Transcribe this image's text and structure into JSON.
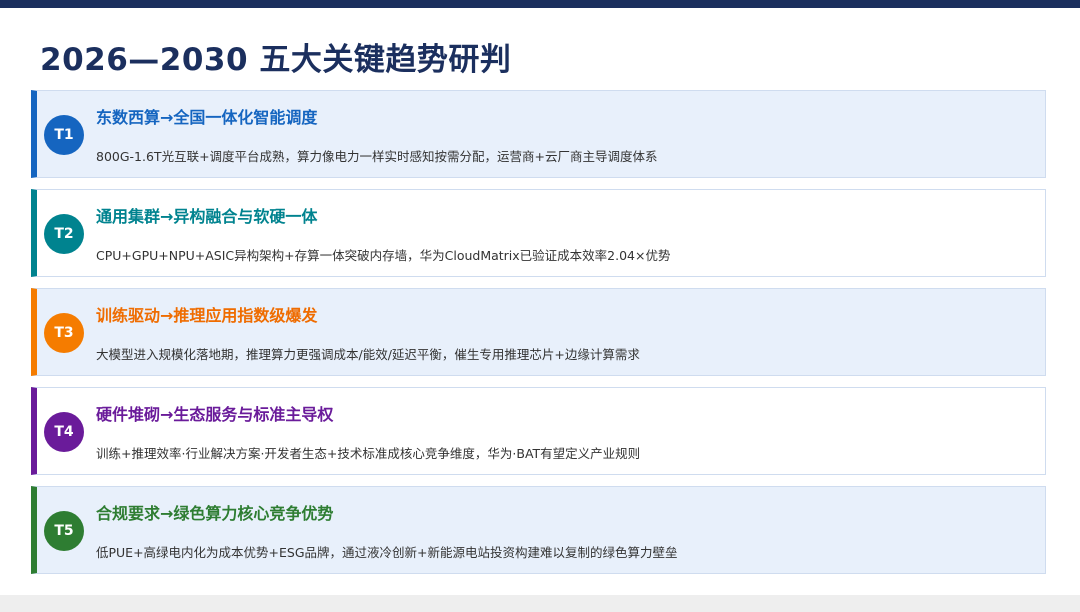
{
  "title": "2026—2030 五大关键趋势研判",
  "trends": [
    {
      "badge": "T1",
      "title": "东数西算→全国一体化智能调度",
      "desc": "800G-1.6T光互联+调度平台成熟，算力像电力一样实时感知按需分配，运营商+云厂商主导调度体系",
      "color": "#1565c0",
      "title_color": "#1565c0"
    },
    {
      "badge": "T2",
      "title": "通用集群→异构融合与软硬一体",
      "desc": "CPU+GPU+NPU+ASIC异构架构+存算一体突破内存墙，华为CloudMatrix已验证成本效率2.04×优势",
      "color": "#00838f",
      "title_color": "#00838f"
    },
    {
      "badge": "T3",
      "title": "训练驱动→推理应用指数级爆发",
      "desc": "大模型进入规模化落地期，推理算力更强调成本/能效/延迟平衡，催生专用推理芯片+边缘计算需求",
      "color": "#f57c00",
      "title_color": "#ef6c00"
    },
    {
      "badge": "T4",
      "title": "硬件堆砌→生态服务与标准主导权",
      "desc": "训练+推理效率·行业解决方案·开发者生态+技术标准成核心竞争维度，华为·BAT有望定义产业规则",
      "color": "#6a1b9a",
      "title_color": "#6a1b9a"
    },
    {
      "badge": "T5",
      "title": "合规要求→绿色算力核心竞争优势",
      "desc": "低PUE+高绿电内化为成本优势+ESG品牌，通过液冷创新+新能源电站投资构建难以复制的绿色算力壁垒",
      "color": "#2e7d32",
      "title_color": "#2e7d32"
    }
  ]
}
